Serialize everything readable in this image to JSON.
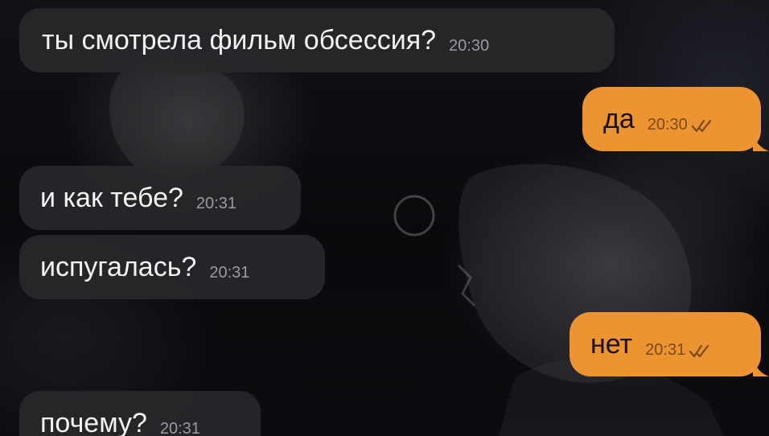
{
  "messages": [
    {
      "direction": "incoming",
      "text": "ты смотрела фильм обсессия?",
      "time": "20:30"
    },
    {
      "direction": "outgoing",
      "text": "да",
      "time": "20:30",
      "status": "read",
      "status_icon": "double-check-icon"
    },
    {
      "direction": "incoming",
      "text": "и как тебе?",
      "time": "20:31"
    },
    {
      "direction": "incoming",
      "text": "испугалась?",
      "time": "20:31"
    },
    {
      "direction": "outgoing",
      "text": "нет",
      "time": "20:31",
      "status": "read",
      "status_icon": "double-check-icon"
    },
    {
      "direction": "incoming",
      "text": "почему?",
      "time": "20:31"
    }
  ],
  "colors": {
    "incoming_bubble": "#28282b",
    "outgoing_bubble": "#ec9332",
    "background": "#0a0a0c"
  }
}
